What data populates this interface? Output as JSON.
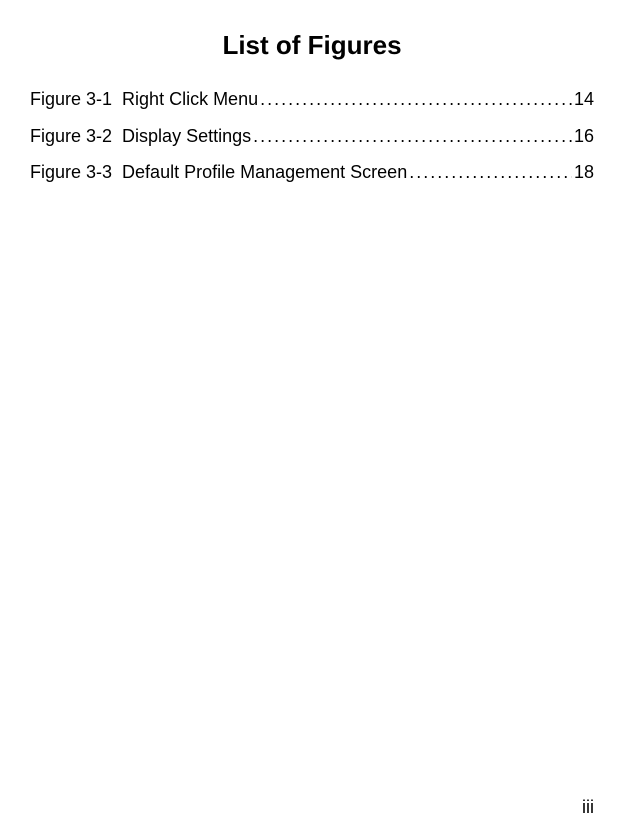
{
  "title": "List of Figures",
  "figures": [
    {
      "label": "Figure 3-1",
      "title": "Right Click Menu",
      "page": "14"
    },
    {
      "label": "Figure 3-2",
      "title": "Display Settings",
      "page": "16"
    },
    {
      "label": "Figure 3-3",
      "title": "Default Profile Management Screen",
      "page": "18"
    }
  ],
  "leader": "........................................................................................................................................................................................",
  "page_number": "iii"
}
